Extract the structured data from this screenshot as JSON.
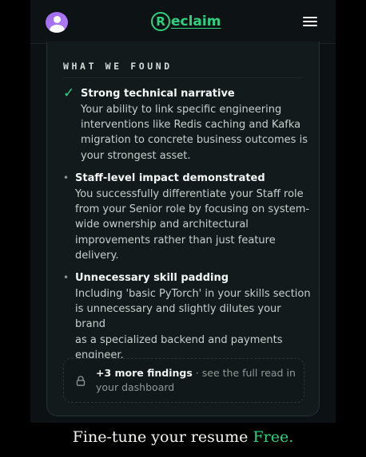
{
  "header": {
    "logo_mark": "R",
    "logo_text": "eclaim",
    "menu_icon": "hamburger-menu-icon",
    "avatar_icon": "user-avatar-icon"
  },
  "section": {
    "title": "WHAT WE FOUND"
  },
  "findings": [
    {
      "marker": "✓",
      "marker_icon": "check-icon",
      "title": "Strong technical narrative",
      "lines": [
        "Your ability to link specific engineering",
        "interventions like Redis caching and Kafka",
        "migration to concrete business outcomes is",
        "your strongest asset."
      ]
    },
    {
      "marker": "•",
      "marker_icon": "bullet-icon",
      "title": "Staff-level impact demonstrated",
      "lines": [
        "You successfully differentiate your Staff role",
        "from your Senior role by focusing on system-",
        "wide ownership and architectural",
        "improvements rather than just feature",
        "delivery."
      ]
    },
    {
      "marker": "•",
      "marker_icon": "bullet-icon",
      "title": "Unnecessary skill padding",
      "lines": [
        "Including 'basic PyTorch' in your skills section",
        "is unnecessary and slightly dilutes your brand",
        "as a specialized backend and payments",
        "engineer."
      ]
    }
  ],
  "more": {
    "icon": "lock-icon",
    "count_label": "+3 more findings",
    "rest_line1": " · see the full read in",
    "rest_line2": "your dashboard"
  },
  "footer": {
    "text": "Fine-tune your resume ",
    "highlight": "Free."
  },
  "colors": {
    "accent": "#2fd17e",
    "background": "#0c1214",
    "card": "#121a1c"
  }
}
